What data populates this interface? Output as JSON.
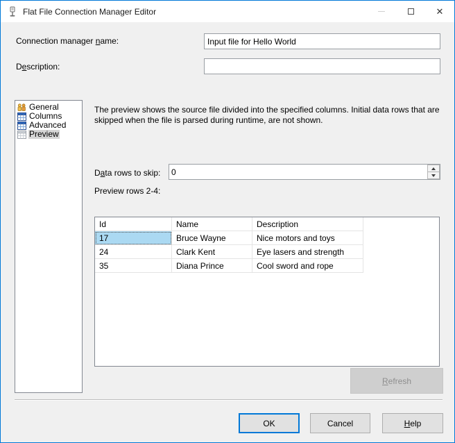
{
  "window": {
    "title": "Flat File Connection Manager Editor",
    "accent_color": "#0078d7",
    "caption_icons": {
      "minimize": "minimize-icon",
      "maximize": "maximize-icon",
      "close": "close-icon"
    }
  },
  "header": {
    "name_label": {
      "pre": "Connection manager ",
      "mnemonic": "n",
      "post": "ame:"
    },
    "name_value": "Input file for Hello World",
    "description_label": {
      "pre": "D",
      "mnemonic": "e",
      "post": "scription:"
    },
    "description_value": ""
  },
  "sidebar": {
    "selection_color": "#d6d6d6",
    "items": [
      {
        "label": "General",
        "icon": "general-icon",
        "selected": false
      },
      {
        "label": "Columns",
        "icon": "columns-icon",
        "selected": false
      },
      {
        "label": "Advanced",
        "icon": "advanced-icon",
        "selected": false
      },
      {
        "label": "Preview",
        "icon": "preview-icon",
        "selected": true
      }
    ]
  },
  "main": {
    "description": "The preview shows the source file divided into the specified columns. Initial data rows that are skipped when the file is parsed during runtime, are not shown.",
    "skip_label": {
      "pre": "D",
      "mnemonic": "a",
      "post": "ta rows to skip:"
    },
    "skip_value": "0",
    "preview_label": "Preview rows 2-4:",
    "table": {
      "selection_color": "#abd9f2",
      "columns": [
        "Id",
        "Name",
        "Description"
      ],
      "rows": [
        {
          "id": "17",
          "name": "Bruce Wayne",
          "description": "Nice motors and toys",
          "selected_cell": "id"
        },
        {
          "id": "24",
          "name": "Clark Kent",
          "description": "Eye lasers and strength",
          "selected_cell": ""
        },
        {
          "id": "35",
          "name": "Diana Prince",
          "description": "Cool sword and rope",
          "selected_cell": ""
        }
      ]
    },
    "refresh_button": {
      "pre": "",
      "mnemonic": "R",
      "post": "efresh",
      "disabled": true
    }
  },
  "footer": {
    "ok_label": "OK",
    "cancel_label": "Cancel",
    "help_label": {
      "pre": "",
      "mnemonic": "H",
      "post": "elp"
    }
  }
}
